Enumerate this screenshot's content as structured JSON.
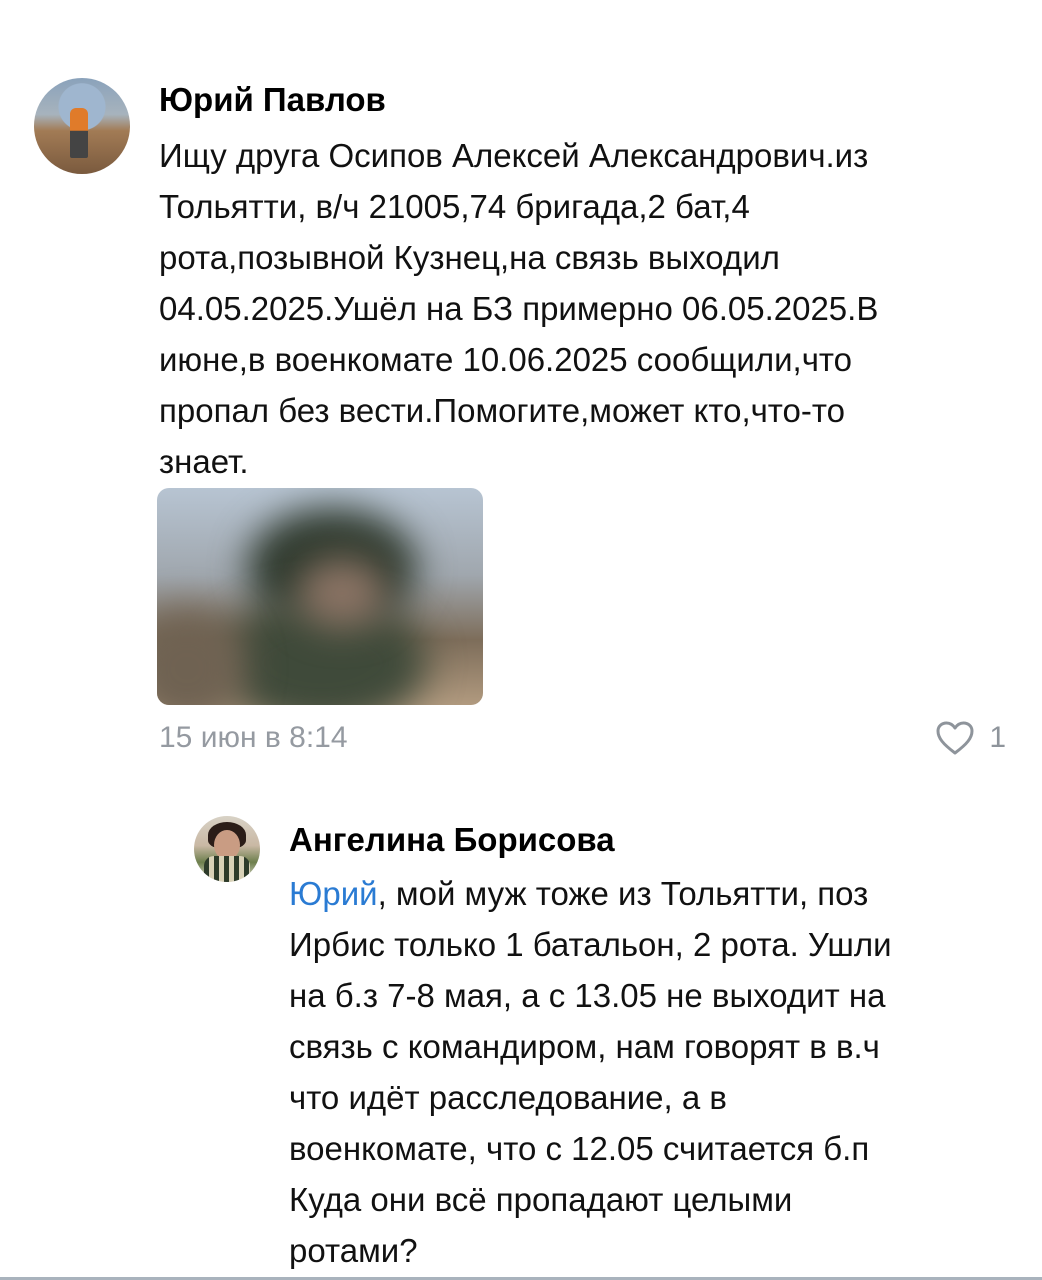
{
  "comments": [
    {
      "author": "Юрий Павлов",
      "text_lines": [
        "Ищу друга Осипов Алексей Александрович.из",
        "Тольятти, в/ч 21005,74 бригада,2 бат,4",
        "рота,позывной Кузнец,на связь выходил",
        "04.05.2025.Ушёл на БЗ примерно 06.05.2025.В",
        "июне,в военкомате 10.06.2025 сообщили,что",
        "пропал без вести.Помогите,может кто,что-то",
        "знает."
      ],
      "timestamp": "15 июн в 8:14",
      "likes": "1"
    },
    {
      "author": "Ангелина Борисова",
      "mention": "Юрий",
      "first_line_rest": ", мой муж тоже из Тольятти, поз",
      "text_lines": [
        "Ирбис только 1 батальон, 2 рота. Ушли",
        "на б.з 7-8 мая, а с 13.05 не выходит на",
        "связь с командиром, нам говорят в в.ч",
        "что идёт расследование, а в",
        "военкомате, что с 12.05 считается б.п",
        "Куда они всё пропадают целыми",
        "ротами?"
      ]
    }
  ],
  "icons": {
    "like": "heart-outline-icon"
  },
  "colors": {
    "mention": "#2a7bd3",
    "meta": "#959aa1"
  }
}
